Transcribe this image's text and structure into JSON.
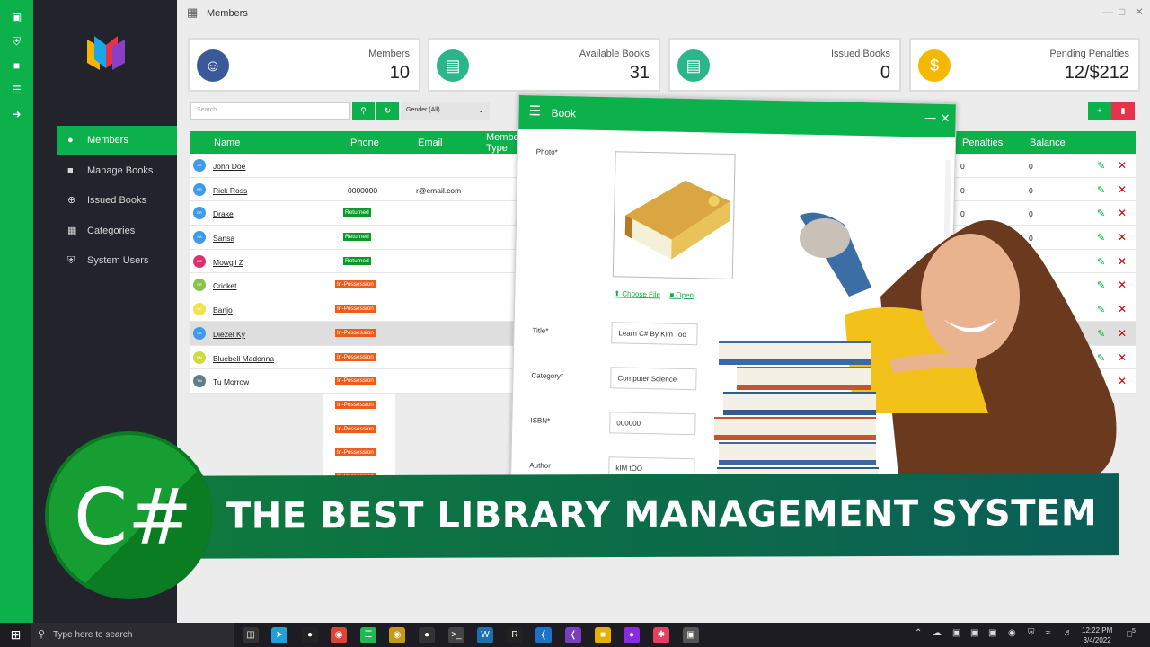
{
  "window": {
    "title": "Members"
  },
  "stats": [
    {
      "label": "Members",
      "value": "10",
      "icon": "member-avatar-icon",
      "color": "#3b5998"
    },
    {
      "label": "Available Books",
      "value": "31",
      "icon": "book-icon",
      "color": "#2bb68a"
    },
    {
      "label": "Issued Books",
      "value": "0",
      "icon": "book-icon",
      "color": "#2bb68a"
    },
    {
      "label": "Pending Penalties",
      "value": "12/$212",
      "icon": "dollar-icon",
      "color": "#f4b800"
    }
  ],
  "nav": [
    {
      "label": "Members",
      "icon": "user-icon",
      "active": true
    },
    {
      "label": "Manage Books",
      "icon": "book-icon"
    },
    {
      "label": "Issued Books",
      "icon": "plus-circle-icon"
    },
    {
      "label": "Categories",
      "icon": "grid-icon"
    },
    {
      "label": "System Users",
      "icon": "shield-icon"
    }
  ],
  "toolbar": {
    "search_placeholder": "Search...",
    "gender_select": "Gender (All)"
  },
  "table": {
    "columns": [
      "Name",
      "Phone",
      "Email",
      "Member Type",
      "Penalties",
      "Balance"
    ],
    "rows": [
      {
        "initials": "JD",
        "name": "John Doe",
        "phone": "",
        "email": "",
        "status": "",
        "penalties": "0",
        "balance": "0",
        "avatar_color": "#3d9be9"
      },
      {
        "initials": "RR",
        "name": "Rick Ross",
        "phone": "0000000",
        "email": "r@email.com",
        "status": "",
        "penalties": "0",
        "balance": "0",
        "avatar_color": "#3d9be9"
      },
      {
        "initials": "DR",
        "name": "Drake",
        "phone": "",
        "email": "",
        "status": "Returned",
        "penalties": "0",
        "balance": "0",
        "avatar_color": "#3d9be9"
      },
      {
        "initials": "SA",
        "name": "Sansa",
        "phone": "",
        "email": "",
        "status": "Returned",
        "penalties": "0",
        "balance": "0",
        "avatar_color": "#3d9be9"
      },
      {
        "initials": "MZ",
        "name": "Mowgli Z",
        "phone": "",
        "email": "",
        "status": "Returned",
        "penalties": "",
        "balance": "",
        "avatar_color": "#e0306b"
      },
      {
        "initials": "CR",
        "name": "Cricket",
        "phone": "",
        "email": "",
        "status": "In-Possession",
        "penalties": "",
        "balance": "",
        "avatar_color": "#8bc34a"
      },
      {
        "initials": "BA",
        "name": "Banjo",
        "phone": "",
        "email": "",
        "status": "In-Possession",
        "penalties": "",
        "balance": "",
        "avatar_color": "#f3e24a"
      },
      {
        "initials": "DK",
        "name": "Diezel Ky",
        "phone": "",
        "email": "",
        "status": "In-Possession",
        "penalties": "",
        "balance": "",
        "avatar_color": "#3d9be9"
      },
      {
        "initials": "BM",
        "name": "Bluebell Madonna",
        "phone": "",
        "email": "",
        "status": "In-Possession",
        "penalties": "",
        "balance": "",
        "avatar_color": "#cddc39"
      },
      {
        "initials": "TM",
        "name": "Tu Morrow",
        "phone": "",
        "email": "",
        "status": "In-Possession",
        "penalties": "",
        "balance": "",
        "avatar_color": "#607d8b"
      }
    ],
    "extra_badges": [
      "In-Possession",
      "In-Possession",
      "In-Possession",
      "In-Possession"
    ]
  },
  "dialog": {
    "title": "Book",
    "photo_label": "Photo*",
    "choose_file": "Choose File",
    "open": "Open",
    "fields": [
      {
        "label": "Title*",
        "value": "Learn C# By Kim Too"
      },
      {
        "label": "Category*",
        "value": "Computer Science"
      },
      {
        "label": "ISBN*",
        "value": "000000"
      },
      {
        "label": "Author",
        "value": "kIM tOO"
      }
    ]
  },
  "banner": {
    "text": "THE BEST LIBRARY MANAGEMENT SYSTEM",
    "logo_text": "C#"
  },
  "taskbar": {
    "search": "Type here to search",
    "time": "12:22 PM",
    "date": "3/4/2022",
    "notifications": "5"
  }
}
